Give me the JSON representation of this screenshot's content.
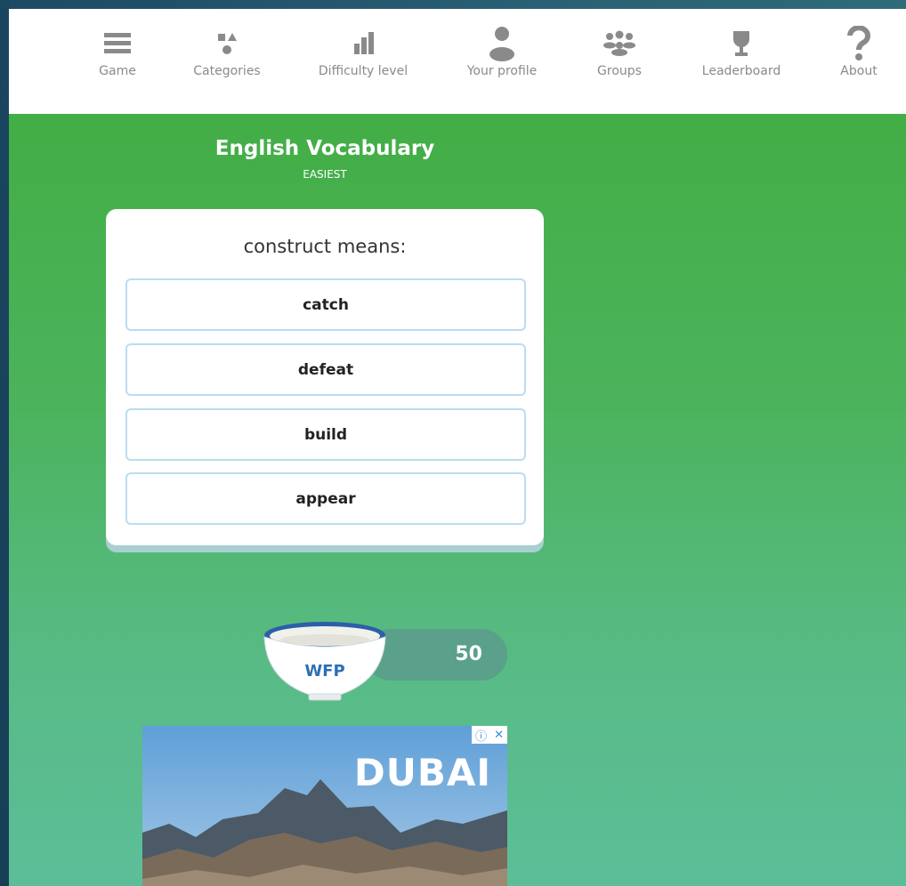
{
  "nav": {
    "items": [
      {
        "label": "Game",
        "icon": "menu-icon"
      },
      {
        "label": "Categories",
        "icon": "categories-icon"
      },
      {
        "label": "Difficulty level",
        "icon": "bar-chart-icon"
      },
      {
        "label": "Your profile",
        "icon": "user-icon"
      },
      {
        "label": "Groups",
        "icon": "group-icon"
      },
      {
        "label": "Leaderboard",
        "icon": "trophy-icon"
      },
      {
        "label": "About",
        "icon": "question-icon"
      }
    ],
    "icon_color": "#8a8a8a"
  },
  "quiz": {
    "title": "English Vocabulary",
    "level": "EASIEST",
    "question": "construct means:",
    "answers": [
      "catch",
      "defeat",
      "build",
      "appear"
    ]
  },
  "score": {
    "label": "WFP",
    "value": "50"
  },
  "ad": {
    "logo_text": "DUBAI",
    "info_icon": "ⓘ",
    "close_icon": "✕"
  },
  "colors": {
    "background_green": "#3fac3d",
    "background_teal": "#5cbe98",
    "answer_border": "#bcdcf2",
    "wfp_blue": "#2d6fb3"
  }
}
